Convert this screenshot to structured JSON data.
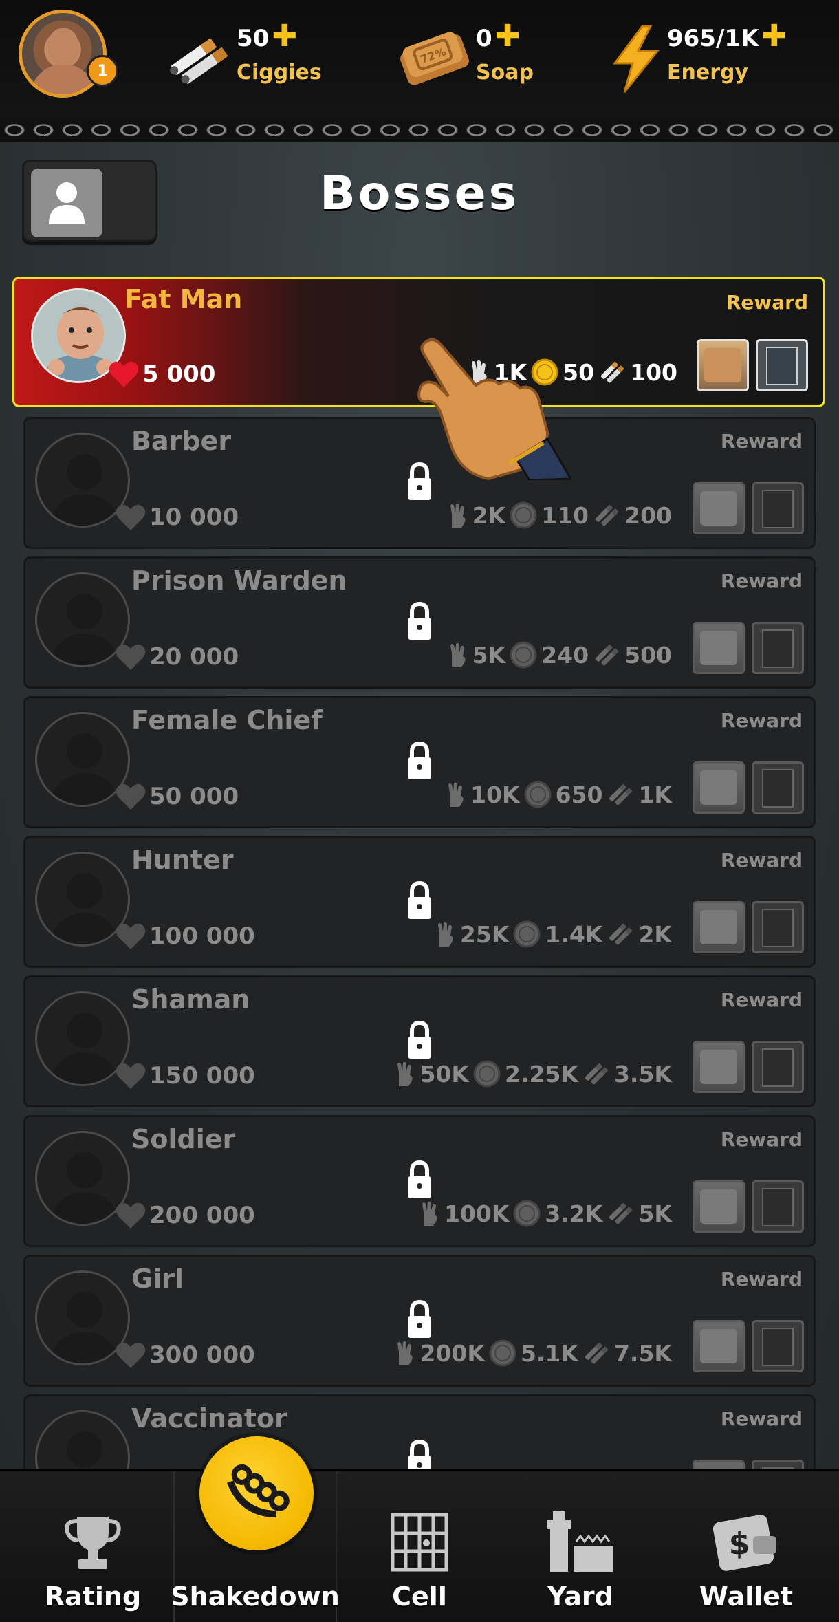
{
  "header": {
    "level": "1",
    "resources": [
      {
        "value": "50",
        "label": "Ciggies",
        "icon": "cigarettes-icon"
      },
      {
        "value": "0",
        "label": "Soap",
        "icon": "soap-icon"
      },
      {
        "value": "965/1K",
        "label": "Energy",
        "icon": "lightning-icon"
      }
    ]
  },
  "page": {
    "title": "Bosses"
  },
  "bosses": [
    {
      "name": "Fat Man",
      "reward_label": "Reward",
      "hp": "5 000",
      "costs": [
        "1K",
        "50",
        "100"
      ],
      "locked": false
    },
    {
      "name": "Barber",
      "reward_label": "Reward",
      "hp": "10 000",
      "costs": [
        "2K",
        "110",
        "200"
      ],
      "locked": true
    },
    {
      "name": "Prison Warden",
      "reward_label": "Reward",
      "hp": "20 000",
      "costs": [
        "5K",
        "240",
        "500"
      ],
      "locked": true
    },
    {
      "name": "Female Chief",
      "reward_label": "Reward",
      "hp": "50 000",
      "costs": [
        "10K",
        "650",
        "1K"
      ],
      "locked": true
    },
    {
      "name": "Hunter",
      "reward_label": "Reward",
      "hp": "100 000",
      "costs": [
        "25K",
        "1.4K",
        "2K"
      ],
      "locked": true
    },
    {
      "name": "Shaman",
      "reward_label": "Reward",
      "hp": "150 000",
      "costs": [
        "50K",
        "2.25K",
        "3.5K"
      ],
      "locked": true
    },
    {
      "name": "Soldier",
      "reward_label": "Reward",
      "hp": "200 000",
      "costs": [
        "100K",
        "3.2K",
        "5K"
      ],
      "locked": true
    },
    {
      "name": "Girl",
      "reward_label": "Reward",
      "hp": "300 000",
      "costs": [
        "200K",
        "5.1K",
        "7.5K"
      ],
      "locked": true
    },
    {
      "name": "Vaccinator",
      "reward_label": "Reward",
      "locked": true
    }
  ],
  "nav": {
    "items": [
      {
        "label": "Rating",
        "icon": "trophy-icon"
      },
      {
        "label": "Shakedown",
        "icon": "brass-knuckles-icon",
        "active": true
      },
      {
        "label": "Cell",
        "icon": "cell-bars-icon"
      },
      {
        "label": "Yard",
        "icon": "yard-tower-icon"
      },
      {
        "label": "Wallet",
        "icon": "wallet-icon"
      }
    ]
  },
  "colors": {
    "accent": "#f4c21a",
    "active_border": "#f4e21e",
    "active_red": "#c01818",
    "title_gold": "#f2b640"
  }
}
